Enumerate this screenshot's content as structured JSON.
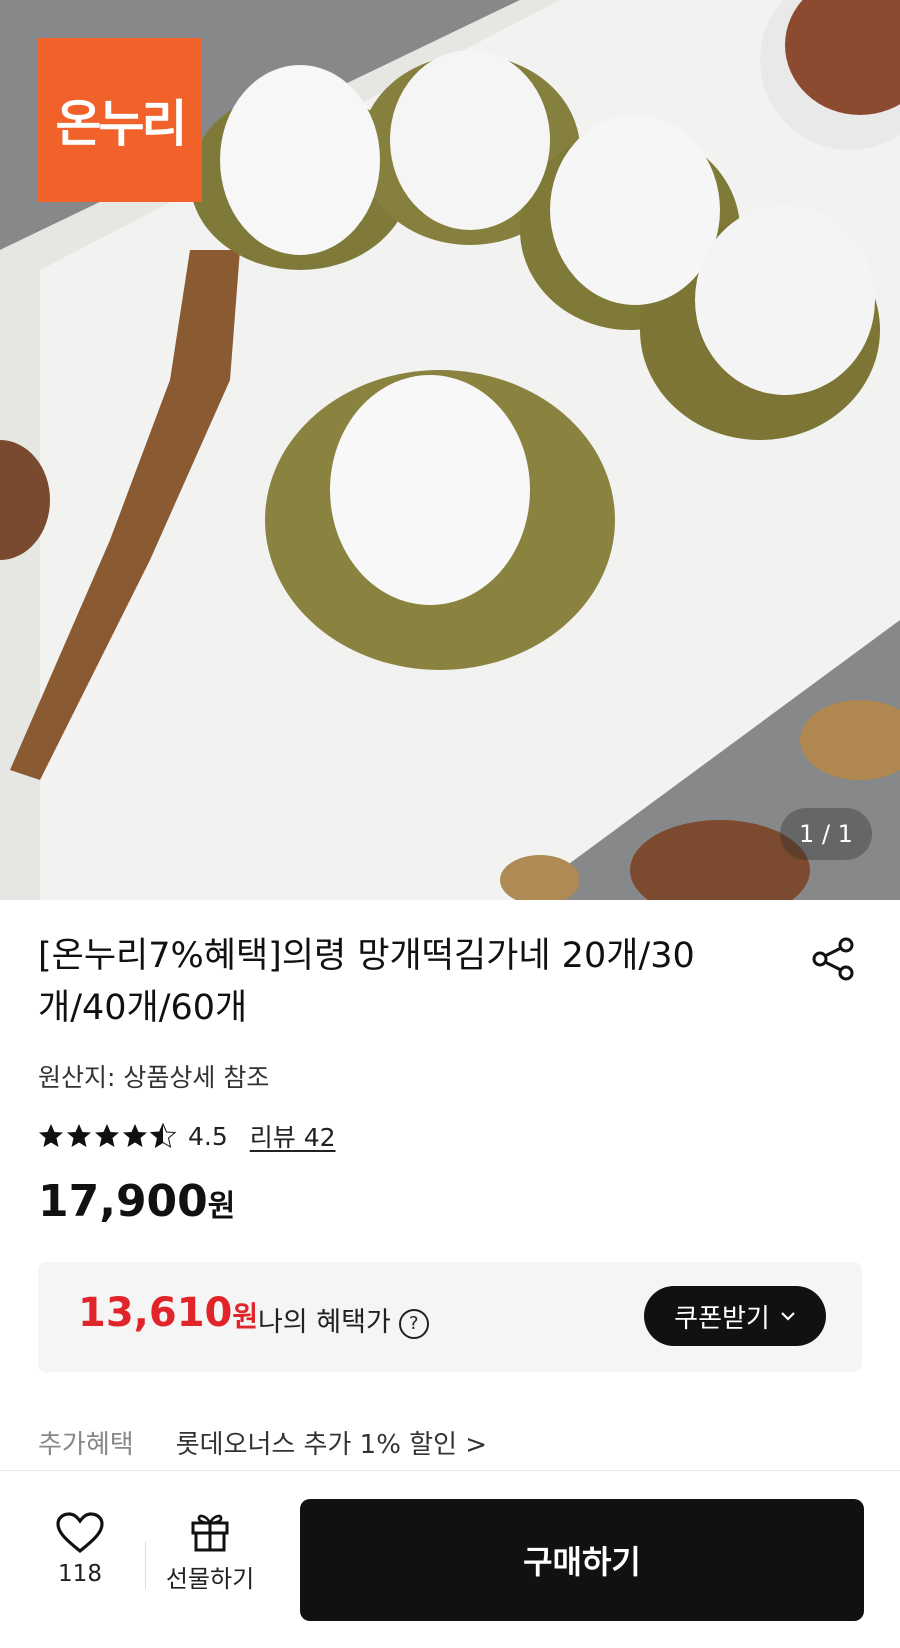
{
  "hero": {
    "logo_text": "온누리",
    "image_counter": "1 / 1"
  },
  "product": {
    "title": "[온누리7%혜택]의령 망개떡김가네 20개/30개/40개/60개",
    "origin": "원산지: 상품상세 참조",
    "rating": "4.5",
    "rating_stars": 4.5,
    "review_link": "리뷰 42",
    "price": "17,900",
    "price_unit": "원"
  },
  "benefit": {
    "price": "13,610",
    "price_unit": "원",
    "label": "나의 혜택가",
    "help_icon_text": "?",
    "coupon_button": "쿠폰받기",
    "accent_color": "#e0242a"
  },
  "extra": {
    "label": "추가혜택",
    "value": "롯데오너스 추가 1% 할인 >"
  },
  "bottom_bar": {
    "like_count": "118",
    "gift_label": "선물하기",
    "buy_button": "구매하기"
  },
  "colors": {
    "logo_bg": "#f0622a",
    "buy_bg": "#111111"
  }
}
